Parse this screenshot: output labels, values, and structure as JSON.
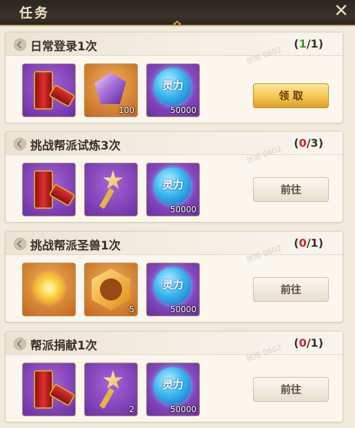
{
  "header": {
    "title": "任务",
    "close_icon": "close-icon"
  },
  "tasks": [
    {
      "name": "日常登录1次",
      "progress_done": "1",
      "progress_sep": "/",
      "progress_total": "1",
      "progress_color": "#3f9a2b",
      "rewards": [
        {
          "icon": "firecracker-icon",
          "rarity": "purple",
          "qty": ""
        },
        {
          "icon": "crystal-icon",
          "rarity": "orange",
          "qty": "100"
        },
        {
          "icon": "lingli-orb-icon",
          "rarity": "purple",
          "label": "灵力",
          "qty": "50000"
        }
      ],
      "button": {
        "label": "领 取",
        "style": "gold"
      }
    },
    {
      "name": "挑战帮派试炼3次",
      "progress_done": "0",
      "progress_sep": "/",
      "progress_total": "3",
      "progress_color": "#c72a2a",
      "rewards": [
        {
          "icon": "firecracker-icon",
          "rarity": "purple",
          "qty": ""
        },
        {
          "icon": "star-key-icon",
          "rarity": "purple",
          "qty": ""
        },
        {
          "icon": "lingli-orb-icon",
          "rarity": "purple",
          "label": "灵力",
          "qty": "50000"
        }
      ],
      "button": {
        "label": "前往",
        "style": "gray"
      }
    },
    {
      "name": "挑战帮派圣兽1次",
      "progress_done": "0",
      "progress_sep": "/",
      "progress_total": "1",
      "progress_color": "#c72a2a",
      "rewards": [
        {
          "icon": "fireworks-icon",
          "rarity": "orange",
          "qty": ""
        },
        {
          "icon": "beast-badge-icon",
          "rarity": "orange",
          "qty": "5"
        },
        {
          "icon": "lingli-orb-icon",
          "rarity": "purple",
          "label": "灵力",
          "qty": "50000"
        }
      ],
      "button": {
        "label": "前往",
        "style": "gray"
      }
    },
    {
      "name": "帮派捐献1次",
      "progress_done": "0",
      "progress_sep": "/",
      "progress_total": "1",
      "progress_color": "#c72a2a",
      "rewards": [
        {
          "icon": "firecracker-icon",
          "rarity": "purple",
          "qty": ""
        },
        {
          "icon": "star-key-icon",
          "rarity": "purple",
          "qty": "2"
        },
        {
          "icon": "lingli-orb-icon",
          "rarity": "purple",
          "label": "灵力",
          "qty": "50000"
        }
      ],
      "button": {
        "label": "前往",
        "style": "gray"
      }
    }
  ],
  "watermark": "张旭 0602"
}
